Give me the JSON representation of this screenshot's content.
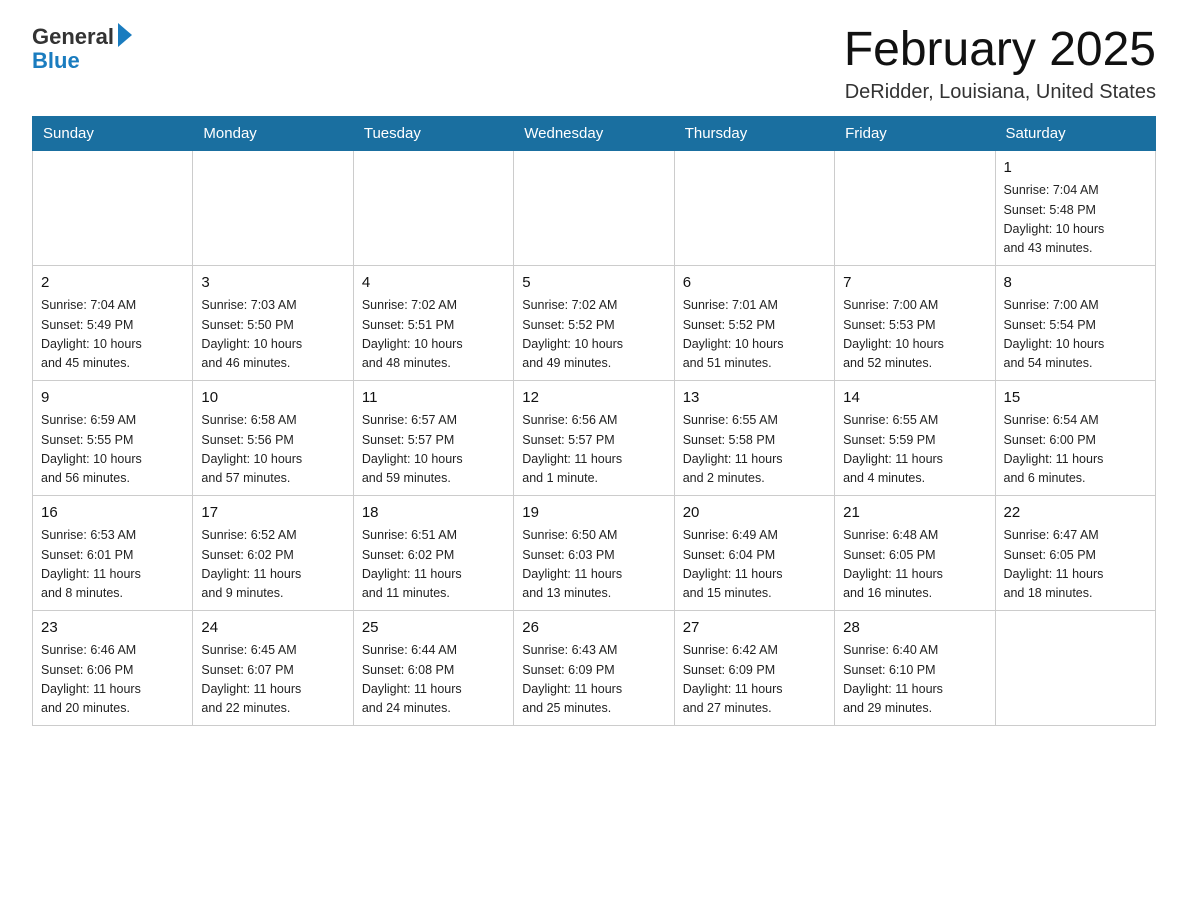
{
  "header": {
    "logo_general": "General",
    "logo_blue": "Blue",
    "title": "February 2025",
    "location": "DeRidder, Louisiana, United States"
  },
  "days_of_week": [
    "Sunday",
    "Monday",
    "Tuesday",
    "Wednesday",
    "Thursday",
    "Friday",
    "Saturday"
  ],
  "weeks": [
    [
      {
        "day": "",
        "info": ""
      },
      {
        "day": "",
        "info": ""
      },
      {
        "day": "",
        "info": ""
      },
      {
        "day": "",
        "info": ""
      },
      {
        "day": "",
        "info": ""
      },
      {
        "day": "",
        "info": ""
      },
      {
        "day": "1",
        "info": "Sunrise: 7:04 AM\nSunset: 5:48 PM\nDaylight: 10 hours\nand 43 minutes."
      }
    ],
    [
      {
        "day": "2",
        "info": "Sunrise: 7:04 AM\nSunset: 5:49 PM\nDaylight: 10 hours\nand 45 minutes."
      },
      {
        "day": "3",
        "info": "Sunrise: 7:03 AM\nSunset: 5:50 PM\nDaylight: 10 hours\nand 46 minutes."
      },
      {
        "day": "4",
        "info": "Sunrise: 7:02 AM\nSunset: 5:51 PM\nDaylight: 10 hours\nand 48 minutes."
      },
      {
        "day": "5",
        "info": "Sunrise: 7:02 AM\nSunset: 5:52 PM\nDaylight: 10 hours\nand 49 minutes."
      },
      {
        "day": "6",
        "info": "Sunrise: 7:01 AM\nSunset: 5:52 PM\nDaylight: 10 hours\nand 51 minutes."
      },
      {
        "day": "7",
        "info": "Sunrise: 7:00 AM\nSunset: 5:53 PM\nDaylight: 10 hours\nand 52 minutes."
      },
      {
        "day": "8",
        "info": "Sunrise: 7:00 AM\nSunset: 5:54 PM\nDaylight: 10 hours\nand 54 minutes."
      }
    ],
    [
      {
        "day": "9",
        "info": "Sunrise: 6:59 AM\nSunset: 5:55 PM\nDaylight: 10 hours\nand 56 minutes."
      },
      {
        "day": "10",
        "info": "Sunrise: 6:58 AM\nSunset: 5:56 PM\nDaylight: 10 hours\nand 57 minutes."
      },
      {
        "day": "11",
        "info": "Sunrise: 6:57 AM\nSunset: 5:57 PM\nDaylight: 10 hours\nand 59 minutes."
      },
      {
        "day": "12",
        "info": "Sunrise: 6:56 AM\nSunset: 5:57 PM\nDaylight: 11 hours\nand 1 minute."
      },
      {
        "day": "13",
        "info": "Sunrise: 6:55 AM\nSunset: 5:58 PM\nDaylight: 11 hours\nand 2 minutes."
      },
      {
        "day": "14",
        "info": "Sunrise: 6:55 AM\nSunset: 5:59 PM\nDaylight: 11 hours\nand 4 minutes."
      },
      {
        "day": "15",
        "info": "Sunrise: 6:54 AM\nSunset: 6:00 PM\nDaylight: 11 hours\nand 6 minutes."
      }
    ],
    [
      {
        "day": "16",
        "info": "Sunrise: 6:53 AM\nSunset: 6:01 PM\nDaylight: 11 hours\nand 8 minutes."
      },
      {
        "day": "17",
        "info": "Sunrise: 6:52 AM\nSunset: 6:02 PM\nDaylight: 11 hours\nand 9 minutes."
      },
      {
        "day": "18",
        "info": "Sunrise: 6:51 AM\nSunset: 6:02 PM\nDaylight: 11 hours\nand 11 minutes."
      },
      {
        "day": "19",
        "info": "Sunrise: 6:50 AM\nSunset: 6:03 PM\nDaylight: 11 hours\nand 13 minutes."
      },
      {
        "day": "20",
        "info": "Sunrise: 6:49 AM\nSunset: 6:04 PM\nDaylight: 11 hours\nand 15 minutes."
      },
      {
        "day": "21",
        "info": "Sunrise: 6:48 AM\nSunset: 6:05 PM\nDaylight: 11 hours\nand 16 minutes."
      },
      {
        "day": "22",
        "info": "Sunrise: 6:47 AM\nSunset: 6:05 PM\nDaylight: 11 hours\nand 18 minutes."
      }
    ],
    [
      {
        "day": "23",
        "info": "Sunrise: 6:46 AM\nSunset: 6:06 PM\nDaylight: 11 hours\nand 20 minutes."
      },
      {
        "day": "24",
        "info": "Sunrise: 6:45 AM\nSunset: 6:07 PM\nDaylight: 11 hours\nand 22 minutes."
      },
      {
        "day": "25",
        "info": "Sunrise: 6:44 AM\nSunset: 6:08 PM\nDaylight: 11 hours\nand 24 minutes."
      },
      {
        "day": "26",
        "info": "Sunrise: 6:43 AM\nSunset: 6:09 PM\nDaylight: 11 hours\nand 25 minutes."
      },
      {
        "day": "27",
        "info": "Sunrise: 6:42 AM\nSunset: 6:09 PM\nDaylight: 11 hours\nand 27 minutes."
      },
      {
        "day": "28",
        "info": "Sunrise: 6:40 AM\nSunset: 6:10 PM\nDaylight: 11 hours\nand 29 minutes."
      },
      {
        "day": "",
        "info": ""
      }
    ]
  ]
}
